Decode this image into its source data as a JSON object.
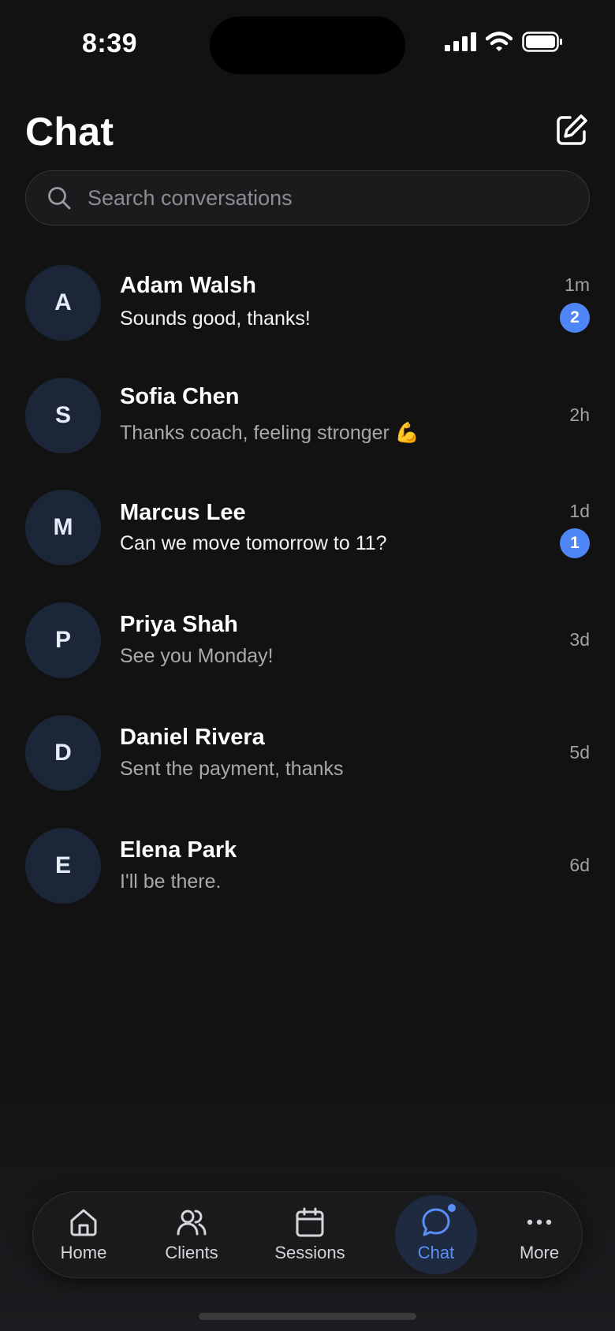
{
  "status_bar": {
    "time": "8:39"
  },
  "header": {
    "title": "Chat"
  },
  "search": {
    "placeholder": "Search conversations"
  },
  "conversations": [
    {
      "initial": "A",
      "name": "Adam Walsh",
      "preview": "Sounds good, thanks!",
      "time": "1m",
      "unread_count": "2",
      "unread": true
    },
    {
      "initial": "S",
      "name": "Sofia Chen",
      "preview": "Thanks coach, feeling stronger 💪",
      "time": "2h",
      "unread": false
    },
    {
      "initial": "M",
      "name": "Marcus Lee",
      "preview": "Can we move tomorrow to 11?",
      "time": "1d",
      "unread_count": "1",
      "unread": true
    },
    {
      "initial": "P",
      "name": "Priya Shah",
      "preview": "See you Monday!",
      "time": "3d",
      "unread": false
    },
    {
      "initial": "D",
      "name": "Daniel Rivera",
      "preview": "Sent the payment, thanks",
      "time": "5d",
      "unread": false
    },
    {
      "initial": "E",
      "name": "Elena Park",
      "preview": "I'll be there.",
      "time": "6d",
      "unread": false
    }
  ],
  "tab_bar": {
    "tabs": [
      {
        "label": "Home",
        "icon": "home-icon",
        "active": false
      },
      {
        "label": "Clients",
        "icon": "users-icon",
        "active": false
      },
      {
        "label": "Sessions",
        "icon": "calendar-icon",
        "active": false
      },
      {
        "label": "Chat",
        "icon": "chat-bubble-icon",
        "active": true
      },
      {
        "label": "More",
        "icon": "more-horizontal-icon",
        "active": false
      }
    ]
  },
  "colors": {
    "accent": "#4f86f7",
    "background": "#121212",
    "avatar_bg": "#1c2639"
  }
}
